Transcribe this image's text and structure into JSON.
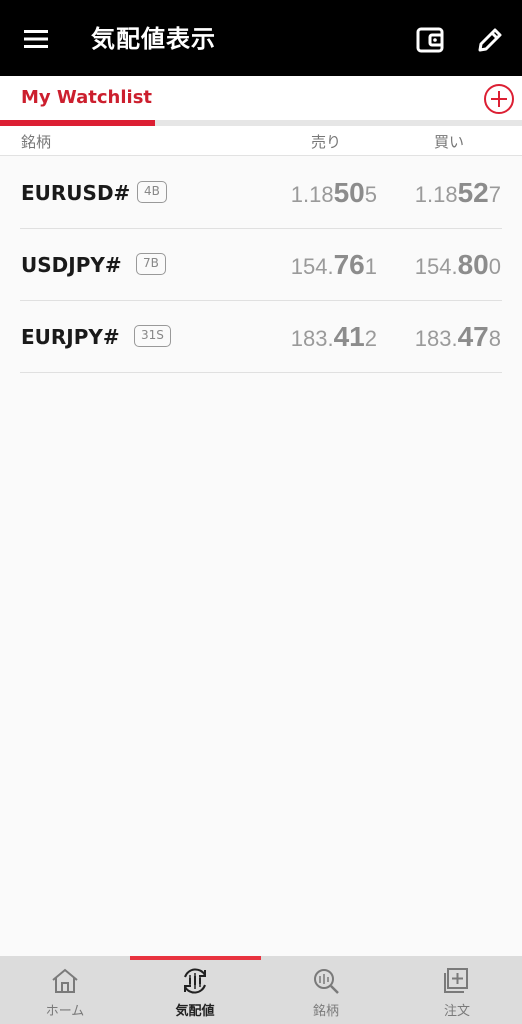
{
  "header": {
    "title": "気配値表示"
  },
  "tabs": {
    "active_label": "My Watchlist"
  },
  "columns": {
    "symbol": "銘柄",
    "sell": "売り",
    "buy": "買い"
  },
  "rows": [
    {
      "symbol": "EURUSD#",
      "badge": "4B",
      "bid": {
        "pre": "1.18",
        "big": "50",
        "suf": "5"
      },
      "ask": {
        "pre": "1.18",
        "big": "52",
        "suf": "7"
      }
    },
    {
      "symbol": "USDJPY#",
      "badge": "7B",
      "bid": {
        "pre": "154.",
        "big": "76",
        "suf": "1"
      },
      "ask": {
        "pre": "154.",
        "big": "80",
        "suf": "0"
      }
    },
    {
      "symbol": "EURJPY#",
      "badge": "31S",
      "bid": {
        "pre": "183.",
        "big": "41",
        "suf": "2"
      },
      "ask": {
        "pre": "183.",
        "big": "47",
        "suf": "8"
      }
    }
  ],
  "bottom_nav": [
    {
      "label": "ホーム",
      "icon": "home-icon"
    },
    {
      "label": "気配値",
      "icon": "quotes-icon",
      "active": true
    },
    {
      "label": "銘柄",
      "icon": "symbol-search-icon"
    },
    {
      "label": "注文",
      "icon": "order-icon"
    }
  ],
  "colors": {
    "accent": "#dc1f33",
    "appbar": "#000000",
    "price": "#9a9a9a"
  }
}
